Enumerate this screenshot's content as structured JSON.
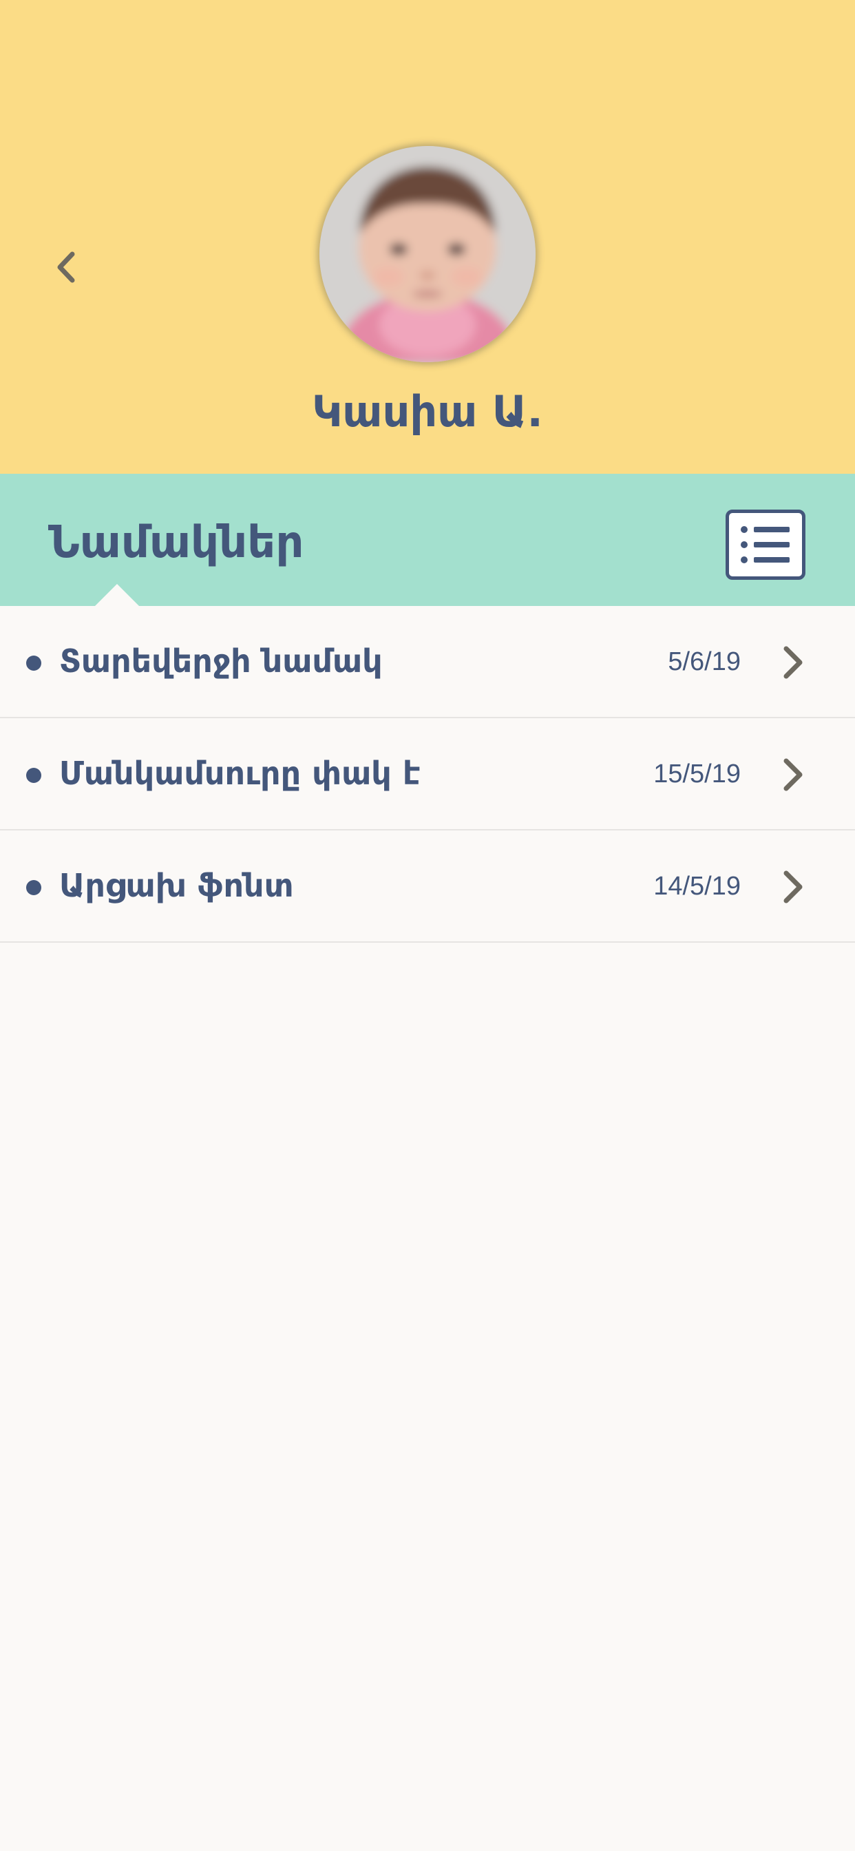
{
  "profile": {
    "name": "Կասիա Ա."
  },
  "section": {
    "title": "Նամակներ"
  },
  "letters": [
    {
      "title": "Տարեվերջի նամակ",
      "date": "5/6/19"
    },
    {
      "title": "Մանկամսուրը փակ է",
      "date": "15/5/19"
    },
    {
      "title": "Արցախ ֆոնտ",
      "date": "14/5/19"
    }
  ],
  "colors": {
    "header_bg": "#FBDC86",
    "section_bg": "#A3E0CE",
    "text_primary": "#44577B",
    "page_bg": "#FBF9F7"
  },
  "icons": {
    "back": "chevron-left-icon",
    "list_view": "list-icon",
    "row_arrow": "chevron-right-icon"
  }
}
